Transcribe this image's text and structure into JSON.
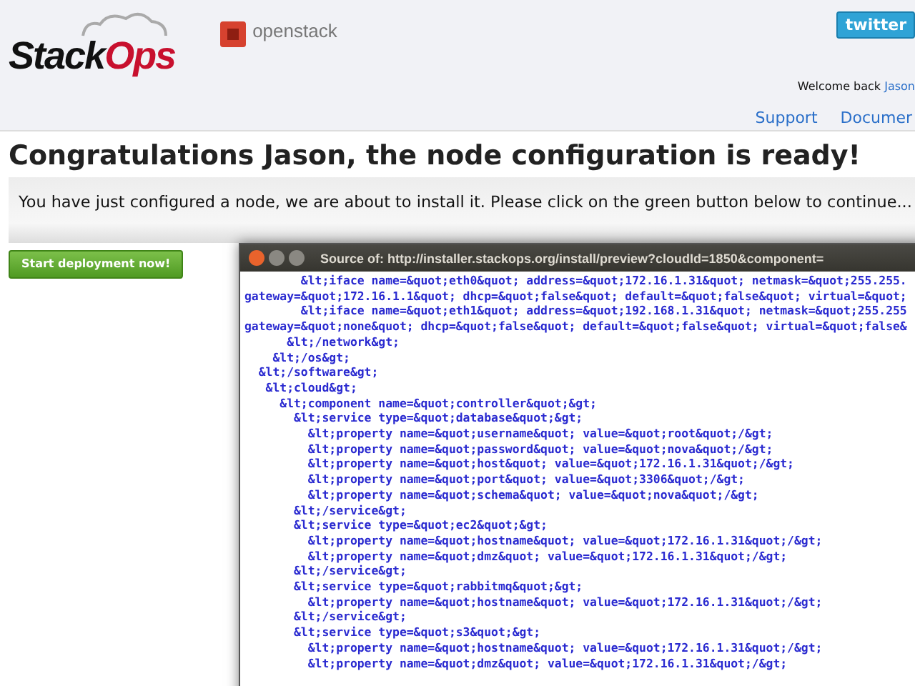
{
  "header": {
    "brand": "StackOps",
    "partner_logo": "openstack",
    "twitter_button": "twitter",
    "welcome": "Welcome back",
    "user_link": "Jason",
    "nav_links": [
      "Support",
      "Documer"
    ]
  },
  "title": "Congratulations Jason, the node configuration is ready!",
  "message": "You have just configured a node, we are about to install it. Please click on the green button below to continue...",
  "button": "Start deployment now!",
  "source_window": {
    "title": "Source of: http://installer.stackops.org/install/preview?cloudId=1850&component=",
    "lines": [
      "        &lt;iface name=&quot;eth0&quot; address=&quot;172.16.1.31&quot; netmask=&quot;255.255.",
      "gateway=&quot;172.16.1.1&quot; dhcp=&quot;false&quot; default=&quot;false&quot; virtual=&quot;",
      "        &lt;iface name=&quot;eth1&quot; address=&quot;192.168.1.31&quot; netmask=&quot;255.255",
      "gateway=&quot;none&quot; dhcp=&quot;false&quot; default=&quot;false&quot; virtual=&quot;false&",
      "      &lt;/network&gt;",
      "    &lt;/os&gt;",
      "  &lt;/software&gt;",
      "   &lt;cloud&gt;",
      "     &lt;component name=&quot;controller&quot;&gt;",
      "       &lt;service type=&quot;database&quot;&gt;",
      "         &lt;property name=&quot;username&quot; value=&quot;root&quot;/&gt;",
      "         &lt;property name=&quot;password&quot; value=&quot;nova&quot;/&gt;",
      "         &lt;property name=&quot;host&quot; value=&quot;172.16.1.31&quot;/&gt;",
      "         &lt;property name=&quot;port&quot; value=&quot;3306&quot;/&gt;",
      "         &lt;property name=&quot;schema&quot; value=&quot;nova&quot;/&gt;",
      "       &lt;/service&gt;",
      "       &lt;service type=&quot;ec2&quot;&gt;",
      "         &lt;property name=&quot;hostname&quot; value=&quot;172.16.1.31&quot;/&gt;",
      "         &lt;property name=&quot;dmz&quot; value=&quot;172.16.1.31&quot;/&gt;",
      "       &lt;/service&gt;",
      "       &lt;service type=&quot;rabbitmq&quot;&gt;",
      "         &lt;property name=&quot;hostname&quot; value=&quot;172.16.1.31&quot;/&gt;",
      "       &lt;/service&gt;",
      "       &lt;service type=&quot;s3&quot;&gt;",
      "         &lt;property name=&quot;hostname&quot; value=&quot;172.16.1.31&quot;/&gt;",
      "         &lt;property name=&quot;dmz&quot; value=&quot;172.16.1.31&quot;/&gt;"
    ]
  }
}
